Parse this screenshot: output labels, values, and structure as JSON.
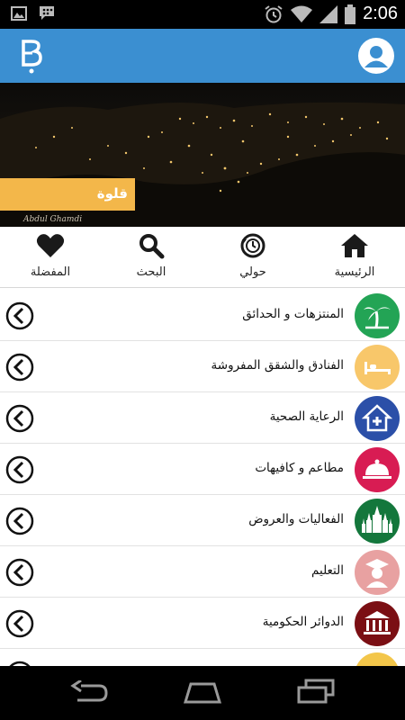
{
  "status_bar": {
    "time": "2:06",
    "icons": [
      "gallery-icon",
      "bbm-icon",
      "alarm-icon",
      "wifi-icon",
      "signal-icon",
      "battery-icon"
    ]
  },
  "app_bar": {
    "color": "#3b8fd1",
    "logo_icon": "b-logo-icon",
    "profile_icon": "user-icon"
  },
  "hero": {
    "location": "قلوة",
    "photo_signature": "Abdul Ghamdi",
    "label_color": "#f3b74a"
  },
  "tabs": [
    {
      "label": "الرئيسية",
      "icon": "home-icon"
    },
    {
      "label": "حولي",
      "icon": "nearby-icon"
    },
    {
      "label": "البحث",
      "icon": "search-icon"
    },
    {
      "label": "المفضلة",
      "icon": "heart-icon"
    }
  ],
  "categories": [
    {
      "label": "المنتزهات و الحدائق",
      "icon": "palm-tree-icon",
      "color": "#23a455"
    },
    {
      "label": "الفنادق والشقق المفروشة",
      "icon": "bed-icon",
      "color": "#f8c76a"
    },
    {
      "label": "الرعاية الصحية",
      "icon": "health-house-icon",
      "color": "#2b4fa8"
    },
    {
      "label": "مطاعم و كافيهات",
      "icon": "food-cloche-icon",
      "color": "#d81c53"
    },
    {
      "label": "الفعاليات والعروض",
      "icon": "palace-icon",
      "color": "#14773c"
    },
    {
      "label": "التعليم",
      "icon": "graduate-icon",
      "color": "#e8a1a1"
    },
    {
      "label": "الدوائر الحكومية",
      "icon": "government-building-icon",
      "color": "#7b0f14"
    }
  ]
}
